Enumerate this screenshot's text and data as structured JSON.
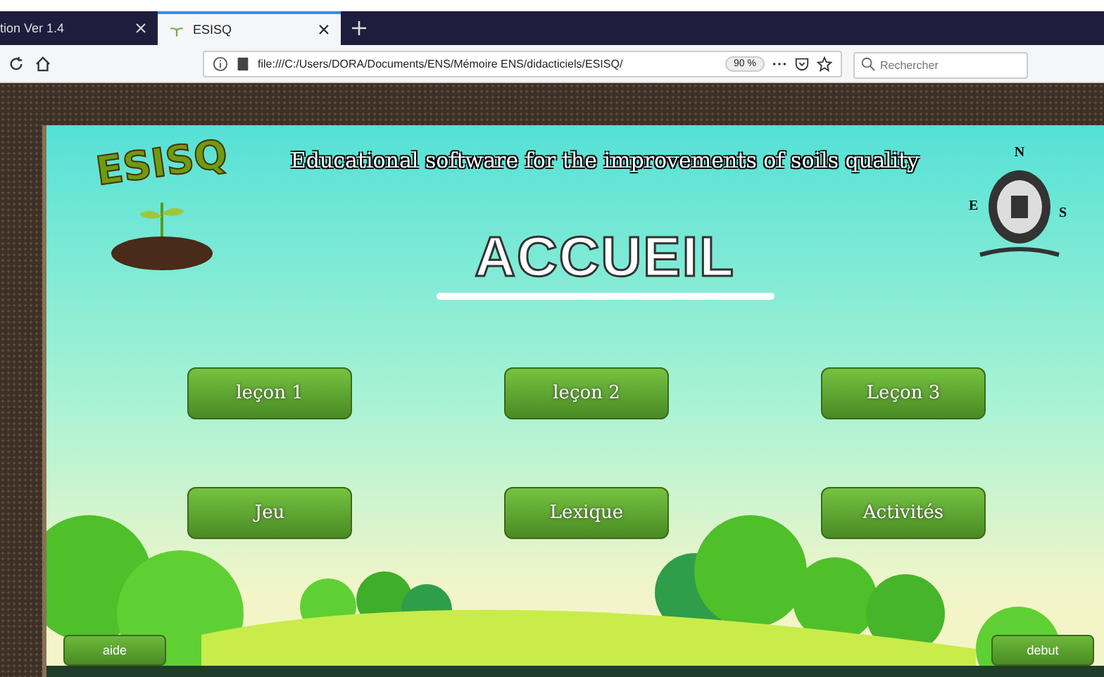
{
  "browser": {
    "tabs": [
      {
        "title": "tion Ver 1.4",
        "selected": false
      },
      {
        "title": "ESISQ",
        "selected": true
      }
    ],
    "url": "file:///C:/Users/DORA/Documents/ENS/Mémoire ENS/didacticiels/ESISQ/",
    "zoom": "90 %",
    "search": {
      "placeholder": "Rechercher"
    }
  },
  "app": {
    "logo": "ESISQ",
    "subtitle": "Educational software for the improvements of soils quality",
    "emblem_letters": [
      "N",
      "E",
      "S"
    ],
    "heading": "ACCUEIL",
    "menu": [
      "leçon 1",
      "leçon 2",
      "Leçon 3",
      "Jeu",
      "Lexique",
      "Activités"
    ],
    "footer": [
      "aide",
      "debut"
    ]
  }
}
